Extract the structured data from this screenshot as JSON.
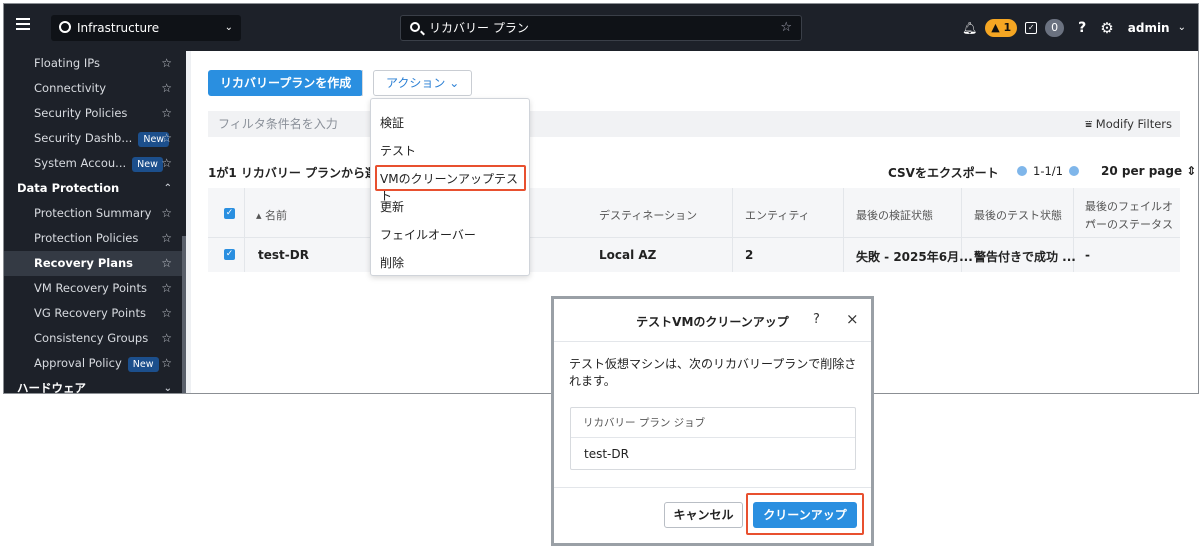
{
  "topbar": {
    "context": "Infrastructure",
    "search_value": "リカバリー プラン",
    "alert_count": "1",
    "task_count": "0",
    "help_label": "?",
    "user": "admin"
  },
  "sidebar": {
    "items": [
      {
        "label": "Floating IPs",
        "new": ""
      },
      {
        "label": "Connectivity",
        "new": ""
      },
      {
        "label": "Security Policies",
        "new": ""
      },
      {
        "label": "Security Dashb...",
        "new": "New"
      },
      {
        "label": "System Accou...",
        "new": "New"
      }
    ],
    "section_dp": "Data Protection",
    "dp_items": [
      {
        "label": "Protection Summary",
        "new": ""
      },
      {
        "label": "Protection Policies",
        "new": ""
      },
      {
        "label": "Recovery Plans",
        "new": ""
      },
      {
        "label": "VM Recovery Points",
        "new": ""
      },
      {
        "label": "VG Recovery Points",
        "new": ""
      },
      {
        "label": "Consistency Groups",
        "new": ""
      },
      {
        "label": "Approval Policy",
        "new": "New"
      }
    ],
    "section_hw": "ハードウェア"
  },
  "toolbar": {
    "create_label": "リカバリープランを作成",
    "action_label": "アクション"
  },
  "filter": {
    "placeholder": "フィルタ条件名を入力",
    "modify_label": "Modify Filters"
  },
  "list": {
    "count_text": "1が1 リカバリー プランから選択さ",
    "csv_label": "CSVをエクスポート",
    "page_range": "1-1/1",
    "per_page": "20 per page"
  },
  "table": {
    "headers": [
      "名前",
      "デスティネーション",
      "エンティティ",
      "最後の検証状態",
      "最後のテスト状態",
      "最後のフェイルオー",
      "バーのステータス"
    ],
    "row": {
      "name": "test-DR",
      "destination": "Local AZ",
      "entities": "2",
      "last_validation": "失敗 - 2025年6月...",
      "last_test": "警告付きで成功 ...",
      "failover_status": "-"
    }
  },
  "action_menu": [
    "検証",
    "テスト",
    "VMのクリーンアップテスト",
    "更新",
    "フェイルオーバー",
    "削除"
  ],
  "dialog": {
    "title": "テストVMのクリーンアップ",
    "help": "?",
    "close": "×",
    "message": "テスト仮想マシンは、次のリカバリープランで削除されます。",
    "job_header": "リカバリー プラン ジョブ",
    "job_value": "test-DR",
    "cancel_label": "キャンセル",
    "confirm_label": "クリーンアップ"
  }
}
